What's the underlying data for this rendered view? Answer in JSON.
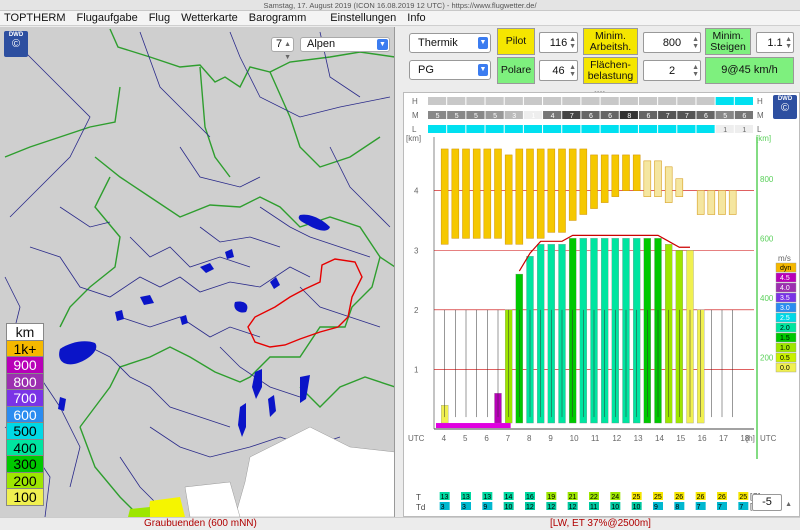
{
  "window": {
    "title": "Samstag, 17. August 2019 (ICON 16.08.2019 12 UTC) - https://www.flugwetter.de/"
  },
  "menu": [
    "TOPTHERM",
    "Flugaufgabe",
    "Flug",
    "Wetterkarte",
    "Barogramm",
    "Einstellungen",
    "Info"
  ],
  "map": {
    "zoom_value": "7",
    "region_selected": "Alpen",
    "logo_text": "DWD",
    "legend_title": "km",
    "legend": [
      {
        "label": "1k+",
        "bg": "#f5b800",
        "fg": "#000000"
      },
      {
        "label": "900",
        "bg": "#b800b8",
        "fg": "#ffffff"
      },
      {
        "label": "800",
        "bg": "#9c2fb0",
        "fg": "#ffffff"
      },
      {
        "label": "700",
        "bg": "#7a33e6",
        "fg": "#ffffff"
      },
      {
        "label": "600",
        "bg": "#2b8cf0",
        "fg": "#ffffff"
      },
      {
        "label": "500",
        "bg": "#00d8e6",
        "fg": "#000000"
      },
      {
        "label": "400",
        "bg": "#00e5a0",
        "fg": "#000000"
      },
      {
        "label": "300",
        "bg": "#00c800",
        "fg": "#000000"
      },
      {
        "label": "200",
        "bg": "#9de600",
        "fg": "#000000"
      },
      {
        "label": "100",
        "bg": "#f0f050",
        "fg": "#000000"
      }
    ]
  },
  "controls": {
    "aircraft_select": "Thermik",
    "pilot_label": "Pilot",
    "pilot_value": "116",
    "min_work_label": "Minim. Arbeitsh.",
    "min_work_value": "800",
    "min_climb_label": "Minim. Steigen",
    "min_climb_value": "1.1",
    "type_select": "PG",
    "polar_label": "Polare",
    "polar_value": "46",
    "wing_load_label": "Flächen- belastung",
    "wing_load_value": "2",
    "result": "9@45 km/h",
    "offset_value": "-5"
  },
  "status": {
    "left": "Graubuenden (600 mNN)",
    "right": "[LW, ET 37%@2500m]"
  },
  "chart_data": {
    "type": "heatmap",
    "cloud_rows": {
      "labels": [
        "H",
        "M",
        "L"
      ],
      "H_values": [
        "",
        "",
        "",
        "",
        "",
        "",
        "",
        "",
        "",
        "",
        "",
        "",
        "",
        "",
        "",
        "",
        ""
      ],
      "M_values": [
        "5",
        "5",
        "5",
        "5",
        "3",
        "1",
        "4",
        "7",
        "6",
        "6",
        "8",
        "6",
        "7",
        "7",
        "6",
        "5",
        "6"
      ],
      "L_values": [
        "",
        "",
        "",
        "",
        "",
        "",
        "",
        "",
        "",
        "",
        "",
        "",
        "",
        "",
        "",
        "1",
        "1"
      ]
    },
    "x_label": "UTC",
    "x_unit": "[h]",
    "x_ticks": [
      "4",
      "5",
      "6",
      "7",
      "8",
      "9",
      "10",
      "11",
      "12",
      "13",
      "14",
      "15",
      "16",
      "17",
      "18"
    ],
    "y_left_label": "[km]",
    "y_left_ticks": [
      "1",
      "2",
      "3",
      "4"
    ],
    "y_right_label": "[km]",
    "y_right_ticks": [
      "200",
      "400",
      "600",
      "800"
    ],
    "climb_legend_title": "m/s",
    "climb_legend": [
      {
        "label": "dyn",
        "bg": "#f5b800"
      },
      {
        "label": "4.5",
        "bg": "#b800b8"
      },
      {
        "label": "4.0",
        "bg": "#9c2fb0"
      },
      {
        "label": "3.5",
        "bg": "#7a33e6"
      },
      {
        "label": "3.0",
        "bg": "#2b8cf0"
      },
      {
        "label": "2.5",
        "bg": "#00d8e6"
      },
      {
        "label": "2.0",
        "bg": "#00e5a0"
      },
      {
        "label": "1.5",
        "bg": "#00c800"
      },
      {
        "label": "1.0",
        "bg": "#9de600"
      },
      {
        "label": "0.5",
        "bg": "#c8f000"
      },
      {
        "label": "0.0",
        "bg": "#f0f050"
      }
    ],
    "T_label": "T",
    "Td_label": "Td",
    "T_unit": "[C]",
    "Td_unit": "[C]",
    "T_values": [
      "13",
      "13",
      "13",
      "14",
      "16",
      "19",
      "21",
      "22",
      "24",
      "25",
      "25",
      "26",
      "26",
      "26",
      "25"
    ],
    "Td_values": [
      "3",
      "3",
      "9",
      "10",
      "12",
      "12",
      "12",
      "11",
      "10",
      "10",
      "9",
      "8",
      "7",
      "7",
      "7"
    ],
    "columns": [
      {
        "x": 4,
        "cloud_base_km": 3.1,
        "cloud_top_km": 4.7,
        "thermal_top_km": 0.4,
        "climb": "0.0"
      },
      {
        "x": 4.5,
        "cloud_base_km": 3.2,
        "cloud_top_km": 4.7,
        "thermal_top_km": 0.0,
        "climb": "0.0"
      },
      {
        "x": 5,
        "cloud_base_km": 3.2,
        "cloud_top_km": 4.7,
        "thermal_top_km": 0.0,
        "climb": "0.0"
      },
      {
        "x": 5.5,
        "cloud_base_km": 3.2,
        "cloud_top_km": 4.7,
        "thermal_top_km": 0.0,
        "climb": "0.0"
      },
      {
        "x": 6,
        "cloud_base_km": 3.2,
        "cloud_top_km": 4.7,
        "thermal_top_km": 0.0,
        "climb": "0.0"
      },
      {
        "x": 6.5,
        "cloud_base_km": 3.2,
        "cloud_top_km": 4.7,
        "thermal_top_km": 0.6,
        "climb": "4.5"
      },
      {
        "x": 7,
        "cloud_base_km": 3.1,
        "cloud_top_km": 4.6,
        "thermal_top_km": 2.0,
        "climb": "1.0"
      },
      {
        "x": 7.5,
        "cloud_base_km": 3.1,
        "cloud_top_km": 4.7,
        "thermal_top_km": 2.6,
        "climb": "1.5"
      },
      {
        "x": 8,
        "cloud_base_km": 3.2,
        "cloud_top_km": 4.7,
        "thermal_top_km": 2.9,
        "climb": "2.0"
      },
      {
        "x": 8.5,
        "cloud_base_km": 3.2,
        "cloud_top_km": 4.7,
        "thermal_top_km": 3.1,
        "climb": "2.0"
      },
      {
        "x": 9,
        "cloud_base_km": 3.3,
        "cloud_top_km": 4.7,
        "thermal_top_km": 3.1,
        "climb": "2.0"
      },
      {
        "x": 9.5,
        "cloud_base_km": 3.3,
        "cloud_top_km": 4.7,
        "thermal_top_km": 3.1,
        "climb": "2.0"
      },
      {
        "x": 10,
        "cloud_base_km": 3.5,
        "cloud_top_km": 4.7,
        "thermal_top_km": 3.2,
        "climb": "1.5"
      },
      {
        "x": 10.5,
        "cloud_base_km": 3.6,
        "cloud_top_km": 4.7,
        "thermal_top_km": 3.2,
        "climb": "2.0"
      },
      {
        "x": 11,
        "cloud_base_km": 3.7,
        "cloud_top_km": 4.6,
        "thermal_top_km": 3.2,
        "climb": "2.0"
      },
      {
        "x": 11.5,
        "cloud_base_km": 3.8,
        "cloud_top_km": 4.6,
        "thermal_top_km": 3.2,
        "climb": "2.0"
      },
      {
        "x": 12,
        "cloud_base_km": 3.9,
        "cloud_top_km": 4.6,
        "thermal_top_km": 3.2,
        "climb": "2.0"
      },
      {
        "x": 12.5,
        "cloud_base_km": 4.0,
        "cloud_top_km": 4.6,
        "thermal_top_km": 3.2,
        "climb": "2.0"
      },
      {
        "x": 13,
        "cloud_base_km": 4.0,
        "cloud_top_km": 4.6,
        "thermal_top_km": 3.2,
        "climb": "2.0"
      },
      {
        "x": 13.5,
        "cloud_base_km": 3.9,
        "cloud_top_km": 4.5,
        "thermal_top_km": 3.2,
        "climb": "1.5"
      },
      {
        "x": 14,
        "cloud_base_km": 3.9,
        "cloud_top_km": 4.5,
        "thermal_top_km": 3.2,
        "climb": "1.5"
      },
      {
        "x": 14.5,
        "cloud_base_km": 3.8,
        "cloud_top_km": 4.4,
        "thermal_top_km": 3.1,
        "climb": "1.0"
      },
      {
        "x": 15,
        "cloud_base_km": 3.9,
        "cloud_top_km": 4.2,
        "thermal_top_km": 3.0,
        "climb": "1.0"
      },
      {
        "x": 15.5,
        "cloud_base_km": 0,
        "cloud_top_km": 0,
        "thermal_top_km": 3.0,
        "climb": "0.0"
      },
      {
        "x": 16,
        "cloud_base_km": 3.6,
        "cloud_top_km": 4.0,
        "thermal_top_km": 2.0,
        "climb": "0.0"
      },
      {
        "x": 16.5,
        "cloud_base_km": 3.6,
        "cloud_top_km": 4.0,
        "thermal_top_km": 0.0,
        "climb": "0.0"
      },
      {
        "x": 17,
        "cloud_base_km": 3.6,
        "cloud_top_km": 4.0,
        "thermal_top_km": 0.0,
        "climb": "0.0"
      },
      {
        "x": 17.5,
        "cloud_base_km": 3.6,
        "cloud_top_km": 4.0,
        "thermal_top_km": 0.0,
        "climb": "0.0"
      }
    ],
    "ylim_km": [
      0,
      4.8
    ],
    "xlim": [
      3.5,
      18.5
    ]
  }
}
